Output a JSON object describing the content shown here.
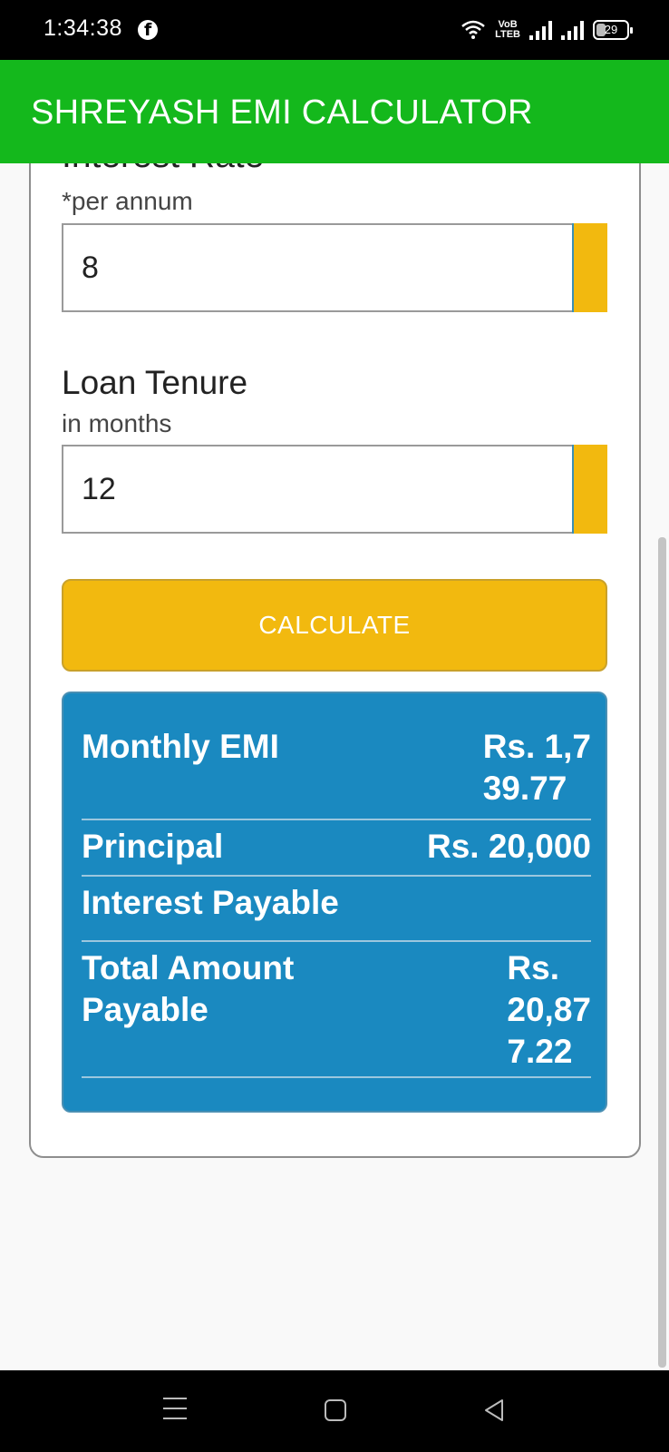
{
  "status_bar": {
    "time": "1:34:38",
    "volte_top": "VoB",
    "volte_bottom": "LTEB",
    "battery": "29",
    "icons": [
      "facebook-icon",
      "wifi-icon",
      "volte-icon",
      "signal-icon",
      "signal-icon",
      "battery-icon"
    ]
  },
  "app_bar": {
    "title": "SHREYASH EMI CALCULATOR"
  },
  "form": {
    "interest_rate_label": "Interest Rate",
    "interest_rate_sublabel": "*per annum",
    "interest_rate_value": "8",
    "loan_tenure_label": "Loan Tenure",
    "loan_tenure_sublabel": "in months",
    "loan_tenure_value": "12",
    "calculate_label": "CALCULATE"
  },
  "results": {
    "monthly_emi_label": "Monthly EMI",
    "monthly_emi_value_line1": "Rs. 1,7",
    "monthly_emi_value_line2": "39.77",
    "principal_label": "Principal",
    "principal_value": "Rs. 20,000",
    "interest_payable_label": "Interest Payable",
    "interest_payable_value": "",
    "total_label_line1": "Total Amount",
    "total_label_line2": "Payable",
    "total_value_line1": "Rs.",
    "total_value_line2": "20,87",
    "total_value_line3": "7.22"
  },
  "colors": {
    "app_bar": "#14b81c",
    "accent_yellow": "#f2b90f",
    "results_blue": "#1a89c0"
  }
}
